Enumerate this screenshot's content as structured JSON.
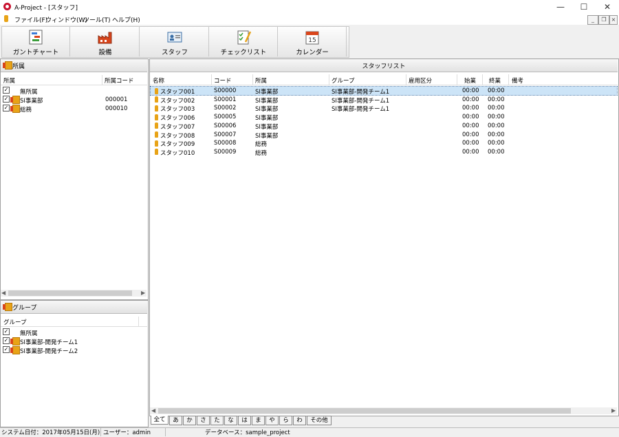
{
  "window": {
    "title": "A-Project - [スタッフ]"
  },
  "menu": [
    "ファイル(F)",
    "ウィンドウ(W)",
    "ツール(T)",
    "ヘルプ(H)"
  ],
  "toolbar": [
    "ガントチャート",
    "設備",
    "スタッフ",
    "チェックリスト",
    "カレンダー"
  ],
  "calendar_day": "15",
  "dept_panel": {
    "title": "所属",
    "columns": [
      "所属",
      "所属コード"
    ],
    "rows": [
      {
        "name": "無所属",
        "code": ""
      },
      {
        "name": "SI事業部",
        "code": "000001"
      },
      {
        "name": "総務",
        "code": "000010"
      }
    ]
  },
  "group_panel": {
    "title": "グループ",
    "column": "グループ",
    "rows": [
      "無所属",
      "SI事業部-開発チーム1",
      "SI事業部-開発チーム2"
    ]
  },
  "staff_list": {
    "title": "スタッフリスト",
    "columns": [
      "名称",
      "コード",
      "所属",
      "グループ",
      "雇用区分",
      "始業",
      "終業",
      "備考"
    ],
    "rows": [
      [
        "スタッフ001",
        "S00000",
        "SI事業部",
        "SI事業部-開発チーム1",
        "",
        "00:00",
        "00:00",
        ""
      ],
      [
        "スタッフ002",
        "S00001",
        "SI事業部",
        "SI事業部-開発チーム1",
        "",
        "00:00",
        "00:00",
        ""
      ],
      [
        "スタッフ003",
        "S00002",
        "SI事業部",
        "SI事業部-開発チーム1",
        "",
        "00:00",
        "00:00",
        ""
      ],
      [
        "スタッフ006",
        "S00005",
        "SI事業部",
        "",
        "",
        "00:00",
        "00:00",
        ""
      ],
      [
        "スタッフ007",
        "S00006",
        "SI事業部",
        "",
        "",
        "00:00",
        "00:00",
        ""
      ],
      [
        "スタッフ008",
        "S00007",
        "SI事業部",
        "",
        "",
        "00:00",
        "00:00",
        ""
      ],
      [
        "スタッフ009",
        "S00008",
        "総務",
        "",
        "",
        "00:00",
        "00:00",
        ""
      ],
      [
        "スタッフ010",
        "S00009",
        "総務",
        "",
        "",
        "00:00",
        "00:00",
        ""
      ]
    ]
  },
  "index_tabs": [
    "全て",
    "あ",
    "か",
    "さ",
    "た",
    "な",
    "は",
    "ま",
    "や",
    "ら",
    "わ",
    "その他"
  ],
  "status": {
    "date": "システム日付：2017年05月15日(月)",
    "user": "ユーザー：admin",
    "db": "データベース：sample_project"
  }
}
